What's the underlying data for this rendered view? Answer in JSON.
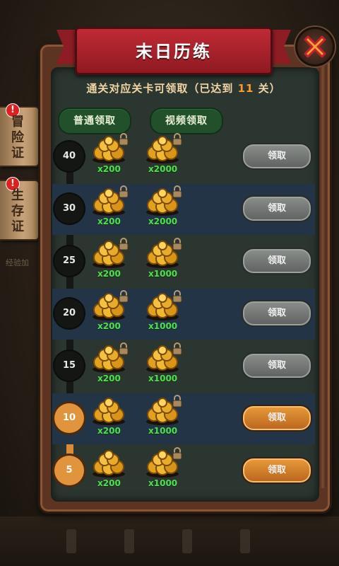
{
  "title": "末日历练",
  "info": {
    "prefix": "通关对应关卡可领取（已达到 ",
    "level": "11",
    "suffix": " 关）"
  },
  "tabs": {
    "normal": "普通领取",
    "video": "视频领取"
  },
  "side_tabs": [
    {
      "label": "冒险证",
      "badge": "!"
    },
    {
      "label": "生存证",
      "badge": "!"
    }
  ],
  "side_exp": "经验加",
  "rows": [
    {
      "level": "40",
      "normal_qty": "x200",
      "video_qty": "x2000",
      "button": "领取",
      "claimable": false,
      "normal_locked": true,
      "video_locked": true
    },
    {
      "level": "30",
      "normal_qty": "x200",
      "video_qty": "x2000",
      "button": "领取",
      "claimable": false,
      "normal_locked": true,
      "video_locked": true
    },
    {
      "level": "25",
      "normal_qty": "x200",
      "video_qty": "x1000",
      "button": "领取",
      "claimable": false,
      "normal_locked": true,
      "video_locked": true
    },
    {
      "level": "20",
      "normal_qty": "x200",
      "video_qty": "x1000",
      "button": "领取",
      "claimable": false,
      "normal_locked": true,
      "video_locked": true
    },
    {
      "level": "15",
      "normal_qty": "x200",
      "video_qty": "x1000",
      "button": "领取",
      "claimable": false,
      "normal_locked": true,
      "video_locked": true
    },
    {
      "level": "10",
      "normal_qty": "x200",
      "video_qty": "x1000",
      "button": "领取",
      "claimable": true,
      "normal_locked": false,
      "video_locked": true
    },
    {
      "level": "5",
      "normal_qty": "x200",
      "video_qty": "x1000",
      "button": "领取",
      "claimable": true,
      "normal_locked": false,
      "video_locked": true
    }
  ],
  "colors": {
    "banner": "#b02530",
    "qty": "#4fe04f",
    "highlight": "#ff9a2a",
    "claim_active": "#d98a30",
    "claim_disabled": "#737775"
  },
  "icons": {
    "close": "close-x-icon",
    "reward": "gold-coin-pile-icon",
    "lock": "padlock-icon",
    "alert": "exclamation-badge-icon"
  }
}
